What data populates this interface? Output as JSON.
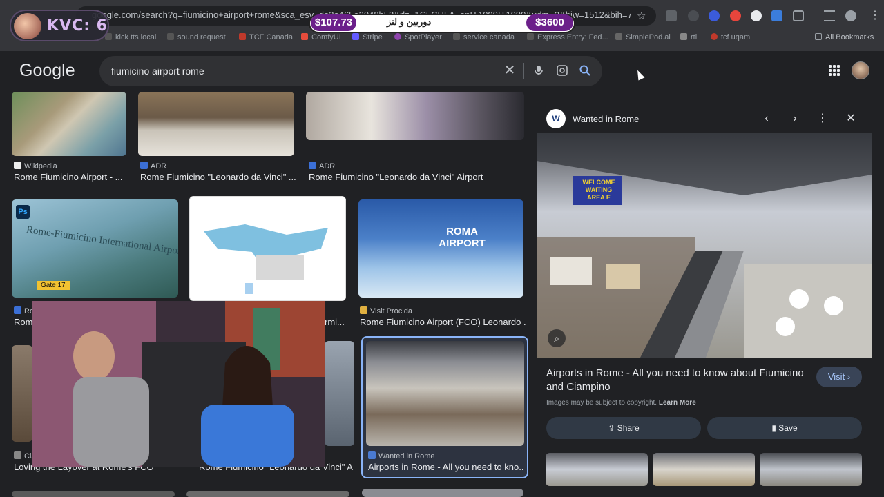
{
  "browser": {
    "url": "google.com/search?q=fiumicino+airport+rome&sca_esv=de3a465e3048b53&rlz=1C5CHFA_enIT1090IT1090&udm=2&biw=1512&bih=7...",
    "bookmarks": [
      "kick tts local",
      "sound request",
      "TCF Canada",
      "ComfyUI",
      "Stripe",
      "SpotPlayer",
      "service canada",
      "Express Entry: Fed...",
      "SimplePod.ai",
      "rtl",
      "tcf uqam",
      "All Bookmarks"
    ]
  },
  "overlay": {
    "badge_label": "KVC: 6",
    "goal_left": "$107.73",
    "goal_text": "دوربین و لنز",
    "goal_right": "$3600"
  },
  "google": {
    "logo": "Google",
    "query": "fiumicino airport rome"
  },
  "results": [
    {
      "source": "Wikipedia",
      "title": "Rome Fiumicino Airport - ..."
    },
    {
      "source": "ADR",
      "title": "Rome Fiumicino \"Leonardo da Vinci\" ..."
    },
    {
      "source": "ADR",
      "title": "Rome Fiumicino \"Leonardo da Vinci\" Airport"
    },
    {
      "source": "Rom",
      "title": "Rom"
    },
    {
      "source": "",
      "title": "rmi..."
    },
    {
      "source": "Visit Procida",
      "title": "Rome Fiumicino Airport (FCO) Leonardo ..."
    },
    {
      "source": "Ciao",
      "title": "Loving the Layover at Rome's FCO"
    },
    {
      "source": "",
      "title": "Rome Fiumicino \"Leonardo da Vinci\" A..."
    },
    {
      "source": "Wanted in Rome",
      "title": "Airports in Rome - All you need to kno..."
    }
  ],
  "thumb_text": {
    "roma_airport": "ROMA AIRPORT",
    "fiumicino_sign": "Rome-Fiumicino International Airport",
    "gate": "Gate 17",
    "ps_icon": "Ps"
  },
  "panel": {
    "source": "Wanted in Rome",
    "title": "Airports in Rome - All you need to know about Fiumicino and Ciampino",
    "visit_label": "Visit",
    "copyright": "Images may be subject to copyright.",
    "learn_more": "Learn More",
    "share_label": "Share",
    "save_label": "Save",
    "image_sign": "WELCOME WAITING AREA E"
  }
}
